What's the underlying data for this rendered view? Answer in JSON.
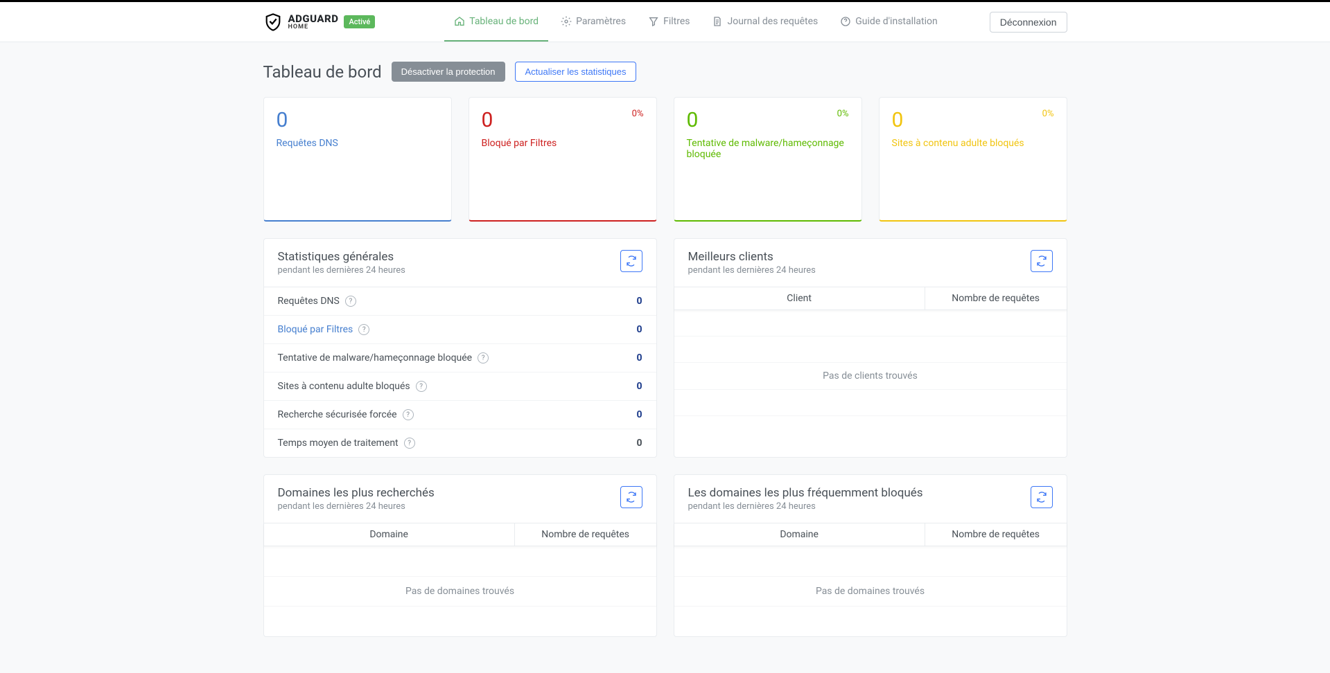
{
  "brand": {
    "name": "ADGUARD",
    "sub": "HOME",
    "status": "Activé"
  },
  "nav": {
    "dashboard": "Tableau de bord",
    "settings": "Paramètres",
    "filters": "Filtres",
    "querylog": "Journal des requêtes",
    "guide": "Guide d'installation",
    "logout": "Déconnexion"
  },
  "page": {
    "title": "Tableau de bord",
    "disable": "Désactiver la protection",
    "refresh": "Actualiser les statistiques"
  },
  "cards": {
    "dns": {
      "value": "0",
      "label": "Requêtes DNS"
    },
    "blocked": {
      "value": "0",
      "label": "Bloqué par Filtres",
      "pct": "0%"
    },
    "malware": {
      "value": "0",
      "label": "Tentative de malware/hameçonnage bloquée",
      "pct": "0%"
    },
    "adult": {
      "value": "0",
      "label": "Sites à contenu adulte bloqués",
      "pct": "0%"
    }
  },
  "generalStats": {
    "title": "Statistiques générales",
    "sub": "pendant les dernières 24 heures",
    "rows": {
      "dns": {
        "label": "Requêtes DNS",
        "val": "0"
      },
      "blocked": {
        "label": "Bloqué par Filtres",
        "val": "0"
      },
      "malware": {
        "label": "Tentative de malware/hameçonnage bloquée",
        "val": "0"
      },
      "adult": {
        "label": "Sites à contenu adulte bloqués",
        "val": "0"
      },
      "safesearch": {
        "label": "Recherche sécurisée forcée",
        "val": "0"
      },
      "avgtime": {
        "label": "Temps moyen de traitement",
        "val": "0"
      }
    }
  },
  "topClients": {
    "title": "Meilleurs clients",
    "sub": "pendant les dernières 24 heures",
    "col1": "Client",
    "col2": "Nombre de requêtes",
    "empty": "Pas de clients trouvés"
  },
  "topQueried": {
    "title": "Domaines les plus recherchés",
    "sub": "pendant les dernières 24 heures",
    "col1": "Domaine",
    "col2": "Nombre de requêtes",
    "empty": "Pas de domaines trouvés"
  },
  "topBlocked": {
    "title": "Les domaines les plus fréquemment bloqués",
    "sub": "pendant les dernières 24 heures",
    "col1": "Domaine",
    "col2": "Nombre de requêtes",
    "empty": "Pas de domaines trouvés"
  }
}
